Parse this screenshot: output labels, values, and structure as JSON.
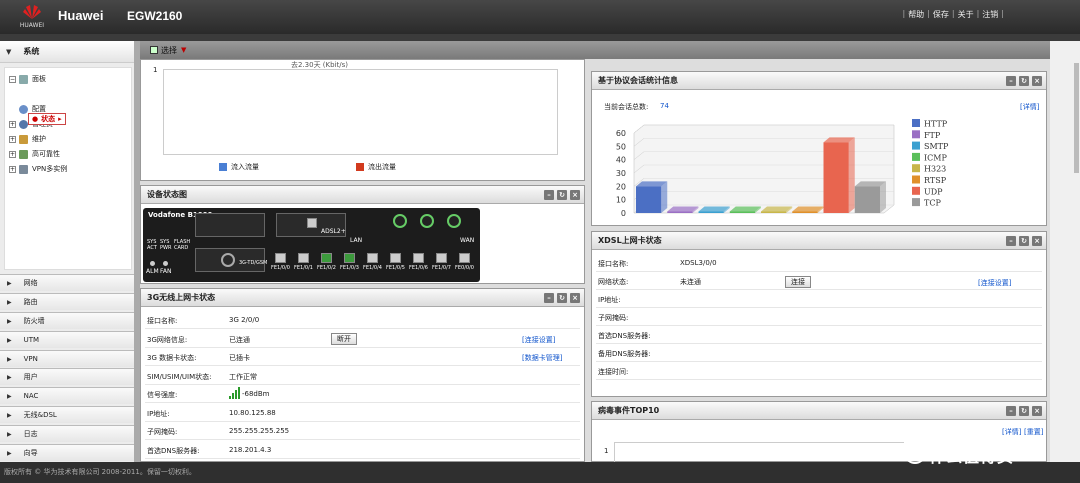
{
  "header": {
    "brand": "Huawei",
    "model": "EGW2160",
    "logo_text": "HUAWEI",
    "links": [
      "帮助",
      "保存",
      "关于",
      "注销"
    ]
  },
  "sidebar": {
    "section_title": "系统",
    "tree": [
      {
        "label": "面板",
        "icon": "dashboard-icon"
      },
      {
        "label": "状态",
        "icon": "status-icon"
      },
      {
        "label": "配置",
        "icon": "config-icon"
      },
      {
        "label": "管理员",
        "icon": "admin-icon"
      },
      {
        "label": "维护",
        "icon": "maintenance-icon"
      },
      {
        "label": "高可靠性",
        "icon": "ha-icon"
      },
      {
        "label": "VPN多实例",
        "icon": "vpn-instance-icon"
      }
    ],
    "nav": [
      "网络",
      "路由",
      "防火墙",
      "UTM",
      "VPN",
      "用户",
      "NAC",
      "无线&DSL",
      "日志",
      "向导"
    ]
  },
  "toolbar": {
    "select_label": "选择"
  },
  "traffic_panel": {
    "y_tick": "1",
    "top_caption": "去2.30天 (Kbit/s)",
    "legend_in": "流入流量",
    "legend_out": "流出流量",
    "in_color": "#4a7fd4",
    "out_color": "#d23a1e"
  },
  "device_panel": {
    "title": "设备状态图",
    "vendor": "Vodafone B1000",
    "adsl": "ADSL2+",
    "lan": "LAN",
    "wan": "WAN",
    "sys_act": "SYS ACT",
    "sys_pwr": "SYS PWR",
    "flash_card": "FLASH CARD",
    "alm": "ALM",
    "fan": "FAN",
    "tdgsm": "3G-TD/GSM",
    "ports": [
      "FE1/0/0",
      "FE1/0/1",
      "FE1/0/2",
      "FE1/0/3",
      "FE1/0/4",
      "FE1/0/5",
      "FE1/0/6",
      "FE1/0/7",
      "FE0/0/0"
    ]
  },
  "g3_panel": {
    "title": "3G无线上网卡状态",
    "rows": [
      {
        "label": "接口名称:",
        "value": "3G 2/0/0"
      },
      {
        "label": "3G网络信息:",
        "value": "已连通"
      },
      {
        "label": "3G 数据卡状态:",
        "value": "已插卡"
      },
      {
        "label": "SIM/USIM/UIM状态:",
        "value": "工作正常"
      },
      {
        "label": "信号强度:",
        "value": "-68dBm"
      },
      {
        "label": "IP地址:",
        "value": "10.80.125.88"
      },
      {
        "label": "子网掩码:",
        "value": "255.255.255.255"
      },
      {
        "label": "首选DNS服务器:",
        "value": "218.201.4.3"
      }
    ],
    "disconnect_label": "断开",
    "conn_settings": "[连接设置]",
    "card_mgmt": "[数据卡管理]"
  },
  "proto_panel": {
    "title": "基于协议会话统计信息",
    "current_label": "当前会话总数:",
    "current_value": "74",
    "detail": "[详情]"
  },
  "chart_data": {
    "type": "bar",
    "categories": [
      "HTTP",
      "FTP",
      "SMTP",
      "ICMP",
      "H323",
      "RTSP",
      "UDP",
      "TCP"
    ],
    "values": [
      20,
      0,
      0,
      0,
      0,
      0,
      53,
      20
    ],
    "colors": [
      "#4b6fc4",
      "#9a6fc4",
      "#3ba0d0",
      "#5abf5a",
      "#c8b64a",
      "#e0902a",
      "#e8654f",
      "#9a9a9a"
    ],
    "yticks": [
      "0",
      "10",
      "20",
      "30",
      "40",
      "50",
      "60"
    ],
    "ylim": [
      0,
      60
    ],
    "legend": "right"
  },
  "xdsl_panel": {
    "title": "XDSL上网卡状态",
    "rows": [
      {
        "label": "接口名称:",
        "value": "XDSL3/0/0"
      },
      {
        "label": "网络状态:",
        "value": "未连通"
      },
      {
        "label": "IP地址:",
        "value": ""
      },
      {
        "label": "子网掩码:",
        "value": ""
      },
      {
        "label": "首选DNS服务器:",
        "value": ""
      },
      {
        "label": "备用DNS服务器:",
        "value": ""
      },
      {
        "label": "连接时间:",
        "value": ""
      }
    ],
    "connect_label": "连接",
    "conn_settings": "[连接设置]"
  },
  "virus_panel": {
    "title": "病毒事件TOP10",
    "detail": "[详情]",
    "reset": "[重置]",
    "y_tick": "1"
  },
  "footer": {
    "copyright": "版权所有 © 华为技术有限公司 2008-2011。保留一切权利。"
  },
  "watermark": {
    "mark": "值",
    "text": "什么值得买"
  }
}
